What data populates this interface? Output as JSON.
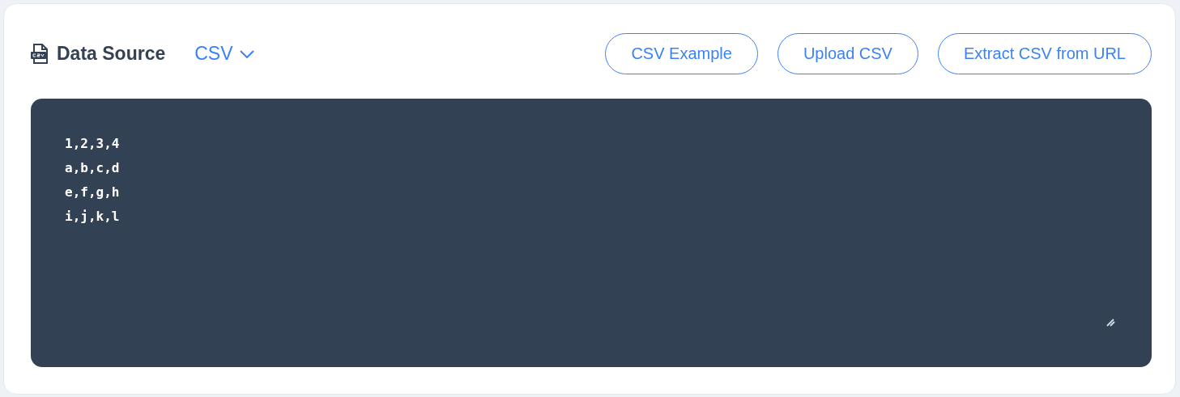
{
  "header": {
    "title": "Data Source",
    "format_dropdown": {
      "value": "CSV"
    },
    "buttons": [
      "CSV Example",
      "Upload CSV",
      "Extract CSV from URL"
    ]
  },
  "editor": {
    "lines": [
      "1,2,3,4",
      "a,b,c,d",
      "e,f,g,h",
      "i,j,k,l"
    ]
  }
}
